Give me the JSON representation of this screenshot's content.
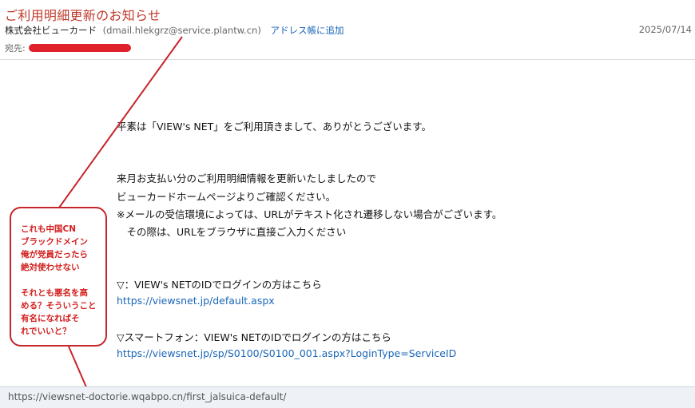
{
  "header": {
    "subject": "ご利用明細更新のお知らせ",
    "sender_name": "株式会社ビューカード",
    "sender_email": "(dmail.hlekgrz@service.plantw.cn)",
    "add_to_contacts": "アドレス帳に追加",
    "date": "2025/07/14",
    "to_label": "宛先:"
  },
  "body": {
    "greeting": "平素は「VIEW's NET」をご利用頂きまして、ありがとうございます。",
    "line1": "来月お支払い分のご利用明細情報を更新いたしましたので",
    "line2": "ビューカードホームページよりご確認ください。",
    "line3": "※メールの受信環境によっては、URLがテキスト化され遷移しない場合がございます。",
    "line4": "　その際は、URLをブラウザに直接ご入力ください",
    "login_label1": "▽：VIEW's NETのIDでログインの方はこちら",
    "login_link1": "https://viewsnet.jp/default.aspx",
    "login_label2": "▽スマートフォン：VIEW's NETのIDでログインの方はこちら",
    "login_link2": "https://viewsnet.jp/sp/S0100/S0100_001.aspx?LoginType=ServiceID"
  },
  "annotation": {
    "lines": [
      "これも中国CN",
      "ブラックドメイン",
      "俺が党員だったら",
      "絶対使わせない",
      "",
      "それとも悪名を高",
      "める？そういうこと",
      "有名になればそ",
      "れでいいと？"
    ],
    "color": "#c6252b"
  },
  "status_bar": {
    "url": "https://viewsnet-doctorie.wqabpo.cn/first_jalsuica-default/"
  }
}
